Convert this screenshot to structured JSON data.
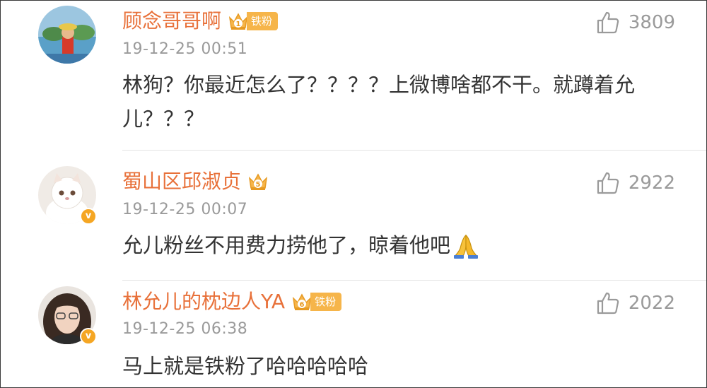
{
  "comments": [
    {
      "username": "顾念哥哥啊",
      "badge_level": "1",
      "badge_label": "铁粉",
      "time": "19-12-25 00:51",
      "text": "林狗？你最近怎么了？？？？上微博啥都不干。就蹲着允儿？？？",
      "likes": "3809",
      "verified": false
    },
    {
      "username": "蜀山区邱淑贞",
      "badge_level": "5",
      "time": "19-12-25 00:07",
      "text": "允儿粉丝不用费力捞他了，晾着他吧",
      "emoji": "pray-emoji",
      "likes": "2922",
      "verified": true,
      "verified_mark": "v"
    },
    {
      "username": "林允儿的枕边人YA",
      "badge_level": "6",
      "badge_label": "铁粉",
      "time": "19-12-25 06:38",
      "text": "马上就是铁粉了哈哈哈哈哈",
      "likes": "2022",
      "verified": true,
      "verified_mark": "v"
    }
  ],
  "icons": {
    "like": "thumbs-up-icon",
    "fan_badge": "crown-icon"
  },
  "colors": {
    "username": "#e8713a",
    "badge": "#f6b54a",
    "meta": "#9a9a9a",
    "text": "#333333",
    "verified": "#f5a623"
  }
}
